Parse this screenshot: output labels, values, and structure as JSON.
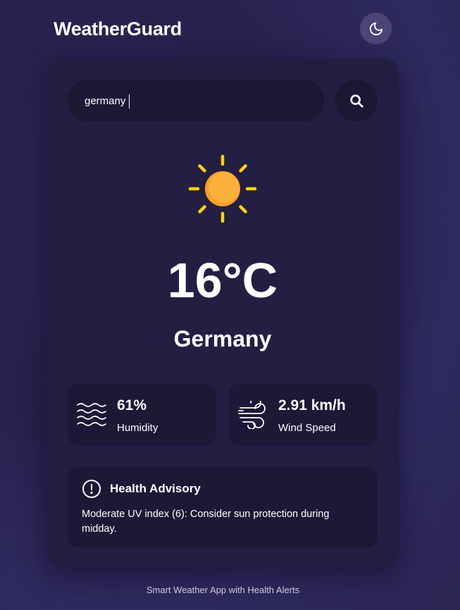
{
  "app": {
    "title": "WeatherGuard"
  },
  "header": {
    "theme_toggle_icon": "moon-icon"
  },
  "search": {
    "value": "germany",
    "placeholder": "",
    "button_icon": "search-icon"
  },
  "weather": {
    "icon": "sun-icon",
    "temperature": "16°C",
    "city": "Germany"
  },
  "stats": {
    "humidity": {
      "icon": "waves-icon",
      "value": "61%",
      "label": "Humidity"
    },
    "wind": {
      "icon": "wind-icon",
      "value": "2.91 km/h",
      "label": "Wind Speed"
    }
  },
  "advisory": {
    "icon": "alert-circle-icon",
    "title": "Health Advisory",
    "text": "Moderate UV index (6): Consider sun protection during midday."
  },
  "footer": {
    "text": "Smart Weather App with Health Alerts"
  },
  "colors": {
    "background": "#2a2552",
    "card": "#231e42",
    "input": "#1c1733",
    "stat_box": "#1d1836",
    "toggle": "#4b4576",
    "sun_core": "#fbb03b",
    "sun_rays": "#fcd116"
  }
}
